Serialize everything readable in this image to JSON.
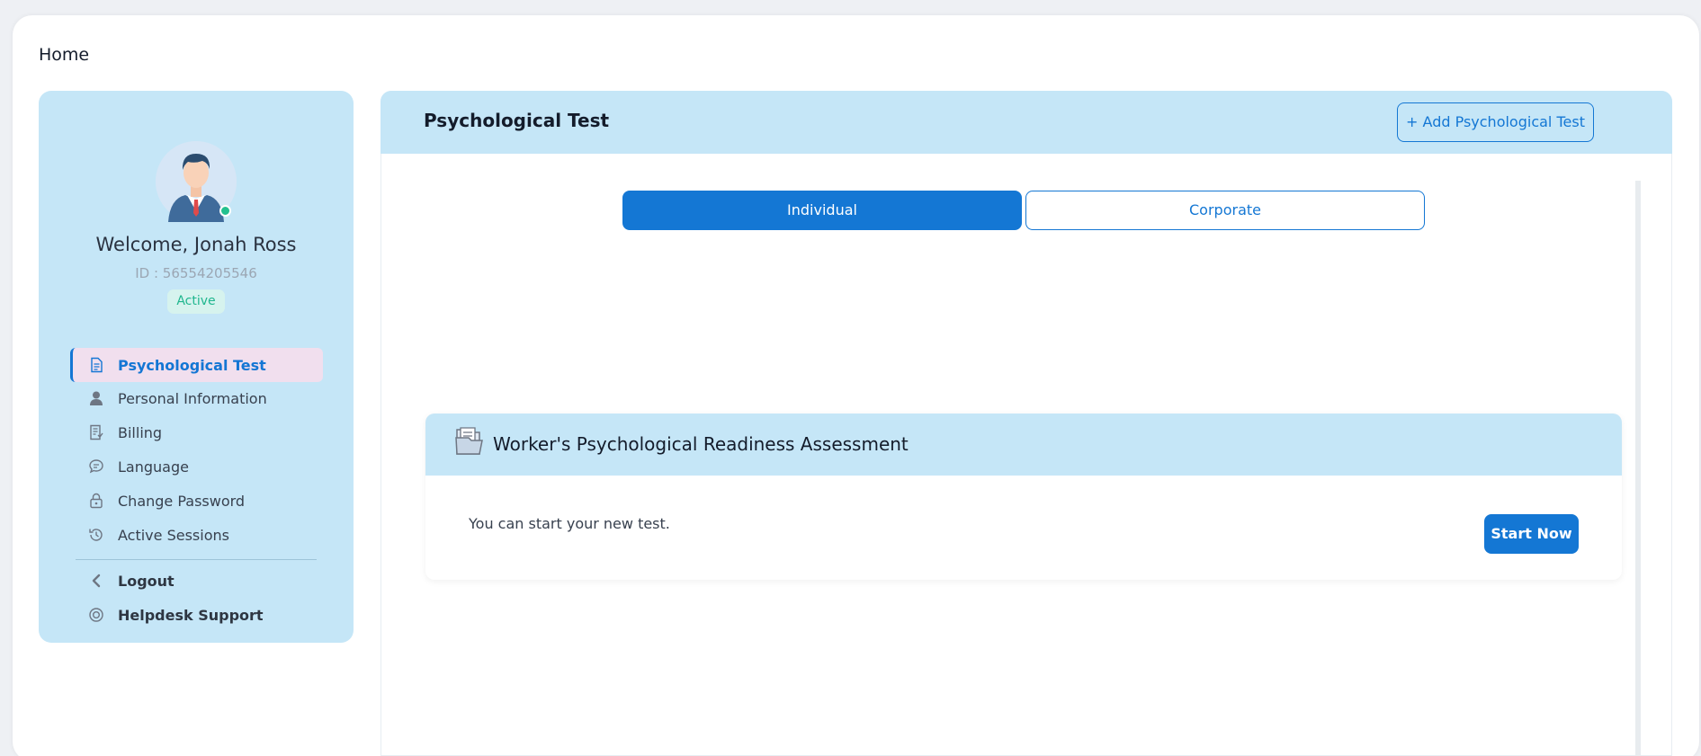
{
  "page": {
    "title": "Home"
  },
  "profile": {
    "welcome": "Welcome, Jonah Ross",
    "id_text": "ID : 56554205546",
    "status": "Active",
    "status_color": "#1fb68e"
  },
  "sidebar": {
    "items": [
      {
        "label": "Psychological Test",
        "icon": "document-icon",
        "active": true
      },
      {
        "label": "Personal Information",
        "icon": "user-icon"
      },
      {
        "label": "Billing",
        "icon": "billing-icon"
      },
      {
        "label": "Language",
        "icon": "chat-bubble-icon"
      },
      {
        "label": "Change Password",
        "icon": "lock-icon"
      },
      {
        "label": "Active Sessions",
        "icon": "history-icon"
      }
    ],
    "footer_items": [
      {
        "label": "Logout",
        "icon": "chevron-left-icon"
      },
      {
        "label": "Helpdesk Support",
        "icon": "support-icon"
      }
    ]
  },
  "main": {
    "title": "Psychological Test",
    "add_button": "+ Add Psychological Test",
    "tabs": [
      {
        "label": "Individual",
        "selected": true
      },
      {
        "label": "Corporate",
        "selected": false
      }
    ],
    "test_card": {
      "title": "Worker's Psychological Readiness Assessment",
      "description": "You can start your new test.",
      "button": "Start Now"
    }
  },
  "colors": {
    "accent": "#1477d4",
    "panel_bg": "#c5e6f7",
    "active_nav_bg": "#f1dfee"
  }
}
